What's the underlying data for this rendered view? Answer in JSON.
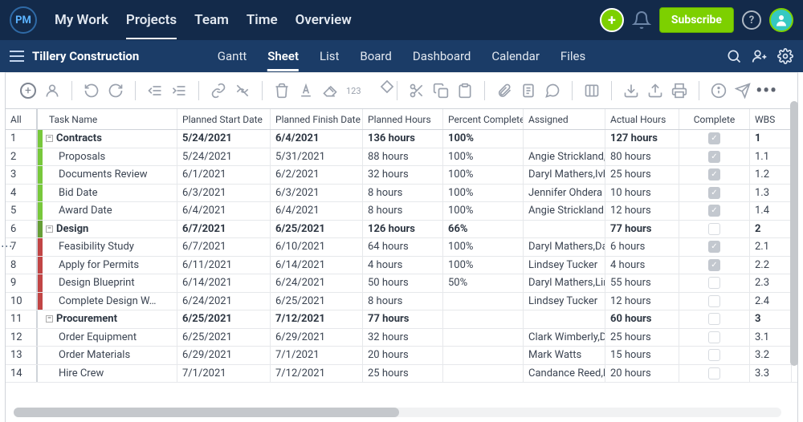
{
  "topnav": {
    "items": [
      "My Work",
      "Projects",
      "Team",
      "Time",
      "Overview"
    ],
    "active": 1
  },
  "subscribe_label": "Subscribe",
  "logo_text": "PM",
  "project_name": "Tillery Construction",
  "viewnav": {
    "items": [
      "Gantt",
      "Sheet",
      "List",
      "Board",
      "Dashboard",
      "Calendar",
      "Files"
    ],
    "active": 1
  },
  "toolbar_123": "123",
  "columns": [
    "All",
    "Task Name",
    "Planned Start Date",
    "Planned Finish Date",
    "Planned Hours",
    "Percent Complete",
    "Assigned",
    "Actual Hours",
    "Complete",
    "WBS"
  ],
  "rows": [
    {
      "num": "1",
      "color": "gb-green",
      "name": "Contracts",
      "group": true,
      "start": "5/24/2021",
      "finish": "6/4/2021",
      "hours": "136 hours",
      "pct": "100%",
      "asn": "",
      "actual": "127 hours",
      "complete": true,
      "wbs": "1"
    },
    {
      "num": "2",
      "color": "gb-green",
      "name": "Proposals",
      "group": false,
      "start": "5/24/2021",
      "finish": "5/31/2021",
      "hours": "88 hours",
      "pct": "100%",
      "asn": "Angie Strickland,Daryl",
      "actual": "80 hours",
      "complete": true,
      "wbs": "1.1"
    },
    {
      "num": "3",
      "color": "gb-green",
      "name": "Documents Review",
      "group": false,
      "start": "6/1/2021",
      "finish": "6/2/2021",
      "hours": "32 hours",
      "pct": "100%",
      "asn": "Daryl Mathers,Ivhan",
      "actual": "25 hours",
      "complete": true,
      "wbs": "1.2"
    },
    {
      "num": "4",
      "color": "gb-green",
      "name": "Bid Date",
      "group": false,
      "start": "6/3/2021",
      "finish": "6/3/2021",
      "hours": "8 hours",
      "pct": "100%",
      "asn": "Jennifer Ohdera",
      "actual": "10 hours",
      "complete": true,
      "wbs": "1.3"
    },
    {
      "num": "5",
      "color": "gb-green",
      "name": "Award Date",
      "group": false,
      "start": "6/4/2021",
      "finish": "6/4/2021",
      "hours": "8 hours",
      "pct": "100%",
      "asn": "Angie Strickland",
      "actual": "12 hours",
      "complete": true,
      "wbs": "1.4"
    },
    {
      "num": "6",
      "color": "gb-green-dk",
      "name": "Design",
      "group": true,
      "start": "6/7/2021",
      "finish": "6/25/2021",
      "hours": "126 hours",
      "pct": "66%",
      "asn": "",
      "actual": "77 hours",
      "complete": false,
      "wbs": "2"
    },
    {
      "num": "7",
      "color": "gb-red",
      "name": "Feasibility Study",
      "group": false,
      "start": "6/7/2021",
      "finish": "6/10/2021",
      "hours": "64 hours",
      "pct": "100%",
      "asn": "Daryl Mathers,Dashawn",
      "actual": "6 hours",
      "complete": true,
      "wbs": "2.1"
    },
    {
      "num": "8",
      "color": "gb-red",
      "name": "Apply for Permits",
      "group": false,
      "start": "6/11/2021",
      "finish": "6/14/2021",
      "hours": "4 hours",
      "pct": "100%",
      "asn": "Lindsey Tucker",
      "actual": "4 hours",
      "complete": true,
      "wbs": "2.2"
    },
    {
      "num": "9",
      "color": "gb-red",
      "name": "Design Blueprint",
      "group": false,
      "start": "6/14/2021",
      "finish": "6/24/2021",
      "hours": "50 hours",
      "pct": "50%",
      "asn": "Daryl Mathers,Lindsey",
      "actual": "55 hours",
      "complete": false,
      "wbs": "2.3"
    },
    {
      "num": "10",
      "color": "gb-red",
      "name": "Complete Design W…",
      "group": false,
      "start": "6/24/2021",
      "finish": "6/25/2021",
      "hours": "8 hours",
      "pct": "",
      "asn": "Lindsey Tucker",
      "actual": "12 hours",
      "complete": false,
      "wbs": "2.4"
    },
    {
      "num": "11",
      "color": "",
      "name": "Procurement",
      "group": true,
      "start": "6/25/2021",
      "finish": "7/12/2021",
      "hours": "77 hours",
      "pct": "",
      "asn": "",
      "actual": "60 hours",
      "complete": false,
      "wbs": "3"
    },
    {
      "num": "12",
      "color": "",
      "name": "Order Equipment",
      "group": false,
      "start": "6/25/2021",
      "finish": "6/29/2021",
      "hours": "32 hours",
      "pct": "",
      "asn": "Clark Wimberly,Daryl",
      "actual": "25 hours",
      "complete": false,
      "wbs": "3.1"
    },
    {
      "num": "13",
      "color": "",
      "name": "Order Materials",
      "group": false,
      "start": "6/29/2021",
      "finish": "7/1/2021",
      "hours": "20 hours",
      "pct": "",
      "asn": "Mark Watts",
      "actual": "15 hours",
      "complete": false,
      "wbs": "3.2"
    },
    {
      "num": "14",
      "color": "",
      "name": "Hire Crew",
      "group": false,
      "start": "7/1/2021",
      "finish": "7/12/2021",
      "hours": "25 hours",
      "pct": "",
      "asn": "Candance Reed,Daryl",
      "actual": "20 hours",
      "complete": false,
      "wbs": "3.3"
    }
  ]
}
